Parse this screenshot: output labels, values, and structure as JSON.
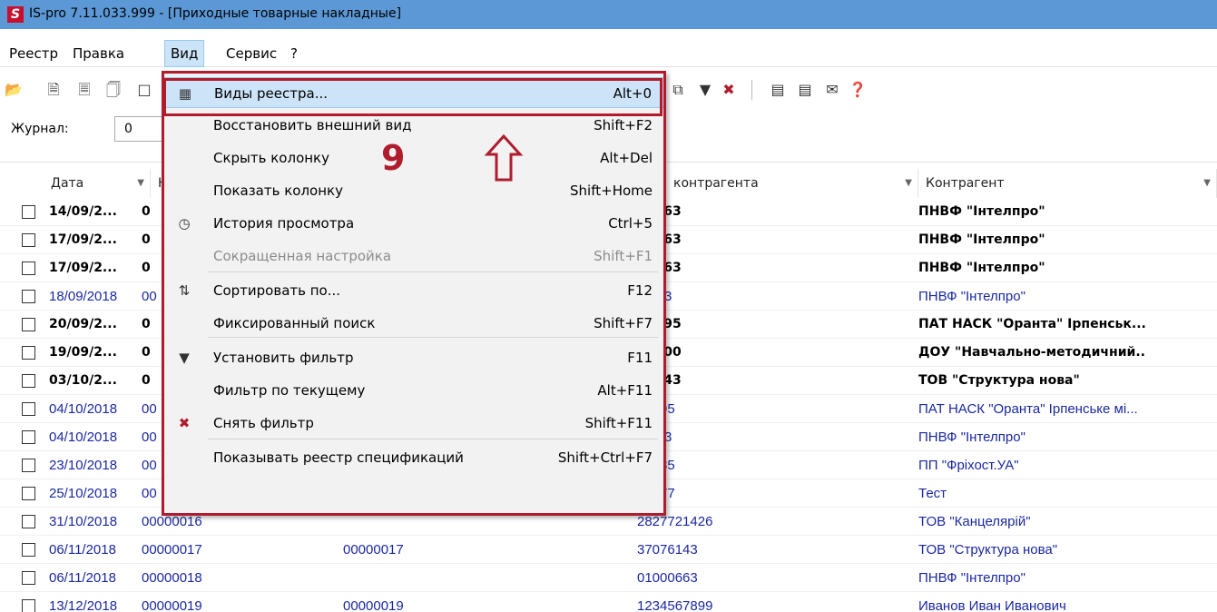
{
  "window": {
    "title": "IS-pro 7.11.033.999 - [Приходные товарные накладные]",
    "logo_text": "S"
  },
  "menubar": [
    {
      "label": "Реестр"
    },
    {
      "label": "Правка"
    },
    {
      "label": "Вид",
      "active": true
    },
    {
      "label": "Сервис"
    },
    {
      "label": "?"
    }
  ],
  "journal": {
    "label": "Журнал:",
    "value": "0"
  },
  "grid": {
    "headers": {
      "date": "Дата",
      "num": "Н",
      "contractor_code": "контрагента",
      "contractor": "Контрагент"
    },
    "rows": [
      {
        "date": "14/09/2...",
        "num": "0",
        "doc": "",
        "code": "00663",
        "contractor": "ПНВФ \"Інтелпро\"",
        "bold": true
      },
      {
        "date": "17/09/2...",
        "num": "0",
        "doc": "",
        "code": "00663",
        "contractor": "ПНВФ \"Інтелпро\"",
        "bold": true
      },
      {
        "date": "17/09/2...",
        "num": "0",
        "doc": "",
        "code": "00663",
        "contractor": "ПНВФ \"Інтелпро\"",
        "bold": true
      },
      {
        "date": "18/09/2018",
        "num": "00",
        "doc": "",
        "code": ")0663",
        "contractor": "ПНВФ \"Інтелпро\"",
        "bold": false
      },
      {
        "date": "20/09/2...",
        "num": "0",
        "doc": "",
        "code": "82995",
        "contractor": "ПАТ  НАСК \"Оранта\" Ірпенськ...",
        "bold": true
      },
      {
        "date": "19/09/2...",
        "num": "0",
        "doc": "",
        "code": "82900",
        "contractor": "ДОУ \"Навчально-методичний..",
        "bold": true
      },
      {
        "date": "03/10/2...",
        "num": "0",
        "doc": "",
        "code": "76143",
        "contractor": "ТОВ \"Структура нова\"",
        "bold": true
      },
      {
        "date": "04/10/2018",
        "num": "00",
        "doc": "",
        "code": "32995",
        "contractor": "ПАТ  НАСК \"Оранта\" Ірпенське мі...",
        "bold": false
      },
      {
        "date": "04/10/2018",
        "num": "00",
        "doc": "",
        "code": ")0663",
        "contractor": "ПНВФ \"Інтелпро\"",
        "bold": false
      },
      {
        "date": "23/10/2018",
        "num": "00",
        "doc": "",
        "code": "53785",
        "contractor": "ПП \"Фріхост.УА\"",
        "bold": false
      },
      {
        "date": "25/10/2018",
        "num": "00",
        "doc": "",
        "code": "22277",
        "contractor": "Тест",
        "bold": false
      },
      {
        "date": "31/10/2018",
        "num": "00000016",
        "doc": "",
        "code": "2827721426",
        "contractor": "ТОВ \"Канцелярій\"",
        "bold": false
      },
      {
        "date": "06/11/2018",
        "num": "00000017",
        "doc": "00000017",
        "code": "37076143",
        "contractor": "ТОВ \"Структура нова\"",
        "bold": false
      },
      {
        "date": "06/11/2018",
        "num": "00000018",
        "doc": "",
        "code": "01000663",
        "contractor": "ПНВФ \"Інтелпро\"",
        "bold": false
      },
      {
        "date": "13/12/2018",
        "num": "00000019",
        "doc": "00000019",
        "code": "1234567899",
        "contractor": "Иванов Иван Иванович",
        "bold": false
      }
    ]
  },
  "dropdown": {
    "items": [
      {
        "icon": "grid-icon",
        "label": "Виды реестра...",
        "shortcut": "Alt+0",
        "highlight": true
      },
      {
        "icon": "",
        "label": "Восстановить внешний вид",
        "shortcut": "Shift+F2"
      },
      {
        "icon": "",
        "label": "Скрыть колонку",
        "shortcut": "Alt+Del"
      },
      {
        "icon": "",
        "label": "Показать колонку",
        "shortcut": "Shift+Home"
      },
      {
        "icon": "history-icon",
        "label": "История просмотра",
        "shortcut": "Ctrl+5"
      },
      {
        "icon": "",
        "label": "Сокращенная настройка",
        "shortcut": "Shift+F1",
        "disabled": true
      },
      {
        "icon": "sort-az-icon",
        "label": "Сортировать по...",
        "shortcut": "F12"
      },
      {
        "icon": "",
        "label": "Фиксированный поиск",
        "shortcut": "Shift+F7"
      },
      {
        "icon": "filter-icon",
        "label": "Установить фильтр",
        "shortcut": "F11"
      },
      {
        "icon": "",
        "label": "Фильтр по текущему",
        "shortcut": "Alt+F11"
      },
      {
        "icon": "remove-filter-icon",
        "label": "Снять фильтр",
        "shortcut": "Shift+F11"
      },
      {
        "icon": "",
        "label": "Показывать реестр спецификаций",
        "shortcut": "Shift+Ctrl+F7"
      }
    ]
  },
  "annotation": {
    "step_number": "9",
    "color": "#b01c2e"
  },
  "colors": {
    "titlebar": "#5b98d5",
    "highlight": "#cde4f8",
    "link_text": "#1a28a0"
  }
}
